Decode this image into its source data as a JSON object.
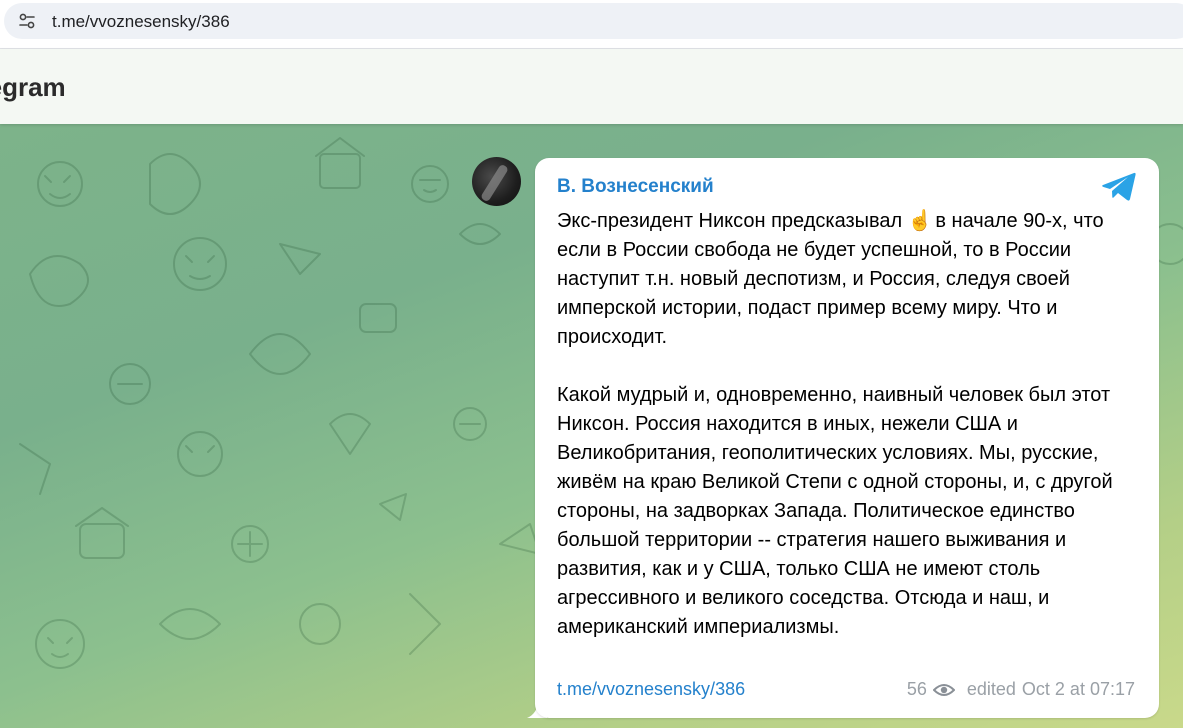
{
  "browser": {
    "url": "t.me/vvoznesensky/386",
    "site_info_icon": "tune-icon"
  },
  "header": {
    "brand": "Telegram",
    "brand_visible": "gram"
  },
  "message": {
    "author": "В. Вознесенский",
    "paragraph1_before_emoji": "Экс-президент Никсон предсказывал ",
    "emoji": "☝️",
    "paragraph1_after_emoji": " в начале 90-х, что если в России свобода не будет успешной, то в России наступит т.н. новый деспотизм, и Россия, следуя своей имперской истории, подаст пример всему миру. Что и происходит.",
    "paragraph2": "Какой мудрый и, одновременно, наивный человек был этот Никсон. Россия находится в иных, нежели США и Великобритания, геополитических условиях. Мы, русские, живём на краю Великой Степи с одной стороны, и, с другой стороны, на задворках Запада. Политическое единство большой территории -- стратегия нашего выживания и развития, как и у США, только США не имеют столь агрессивного и великого соседства. Отсюда и наш, и американский империализмы.",
    "link": "t.me/vvoznesensky/386",
    "views": "56",
    "edited_label": "edited",
    "timestamp": "Oct 2 at 07:17"
  },
  "colors": {
    "accent": "#2481cc",
    "meta_text": "#9aa0a6",
    "chat_bg_top": "#7db38a",
    "chat_bg_bottom": "#c9d98a"
  }
}
